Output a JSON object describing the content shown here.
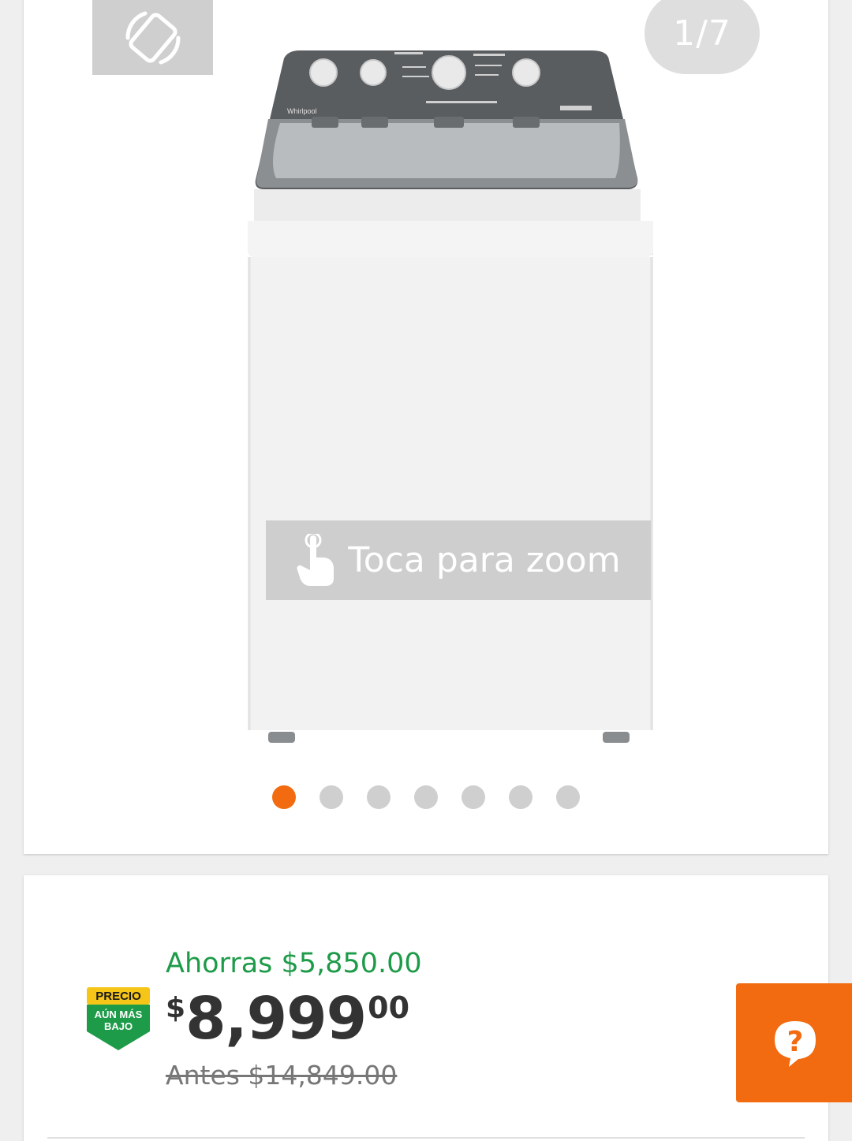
{
  "gallery": {
    "counter": "1/7",
    "zoom_hint": "Toca para zoom",
    "rotate_icon": "screen-rotation-icon",
    "zoom_icon": "tap-hand-icon",
    "total_images": 7,
    "active_index": 0,
    "product_brand_text": "Whirlpool"
  },
  "price": {
    "savings": "Ahorras $5,850.00",
    "currency": "$",
    "whole": "8,999",
    "cents": "00",
    "before": "Antes $14,849.00",
    "badge": {
      "line1": "PRECIO",
      "line2": "AÚN MÁS",
      "line3": "BAJO"
    }
  },
  "help": {
    "icon": "help-bubble-icon"
  },
  "colors": {
    "accent": "#f26b10",
    "savings_green": "#1e9b49",
    "badge_yellow": "#f5c518",
    "badge_green": "#1e9b49"
  }
}
